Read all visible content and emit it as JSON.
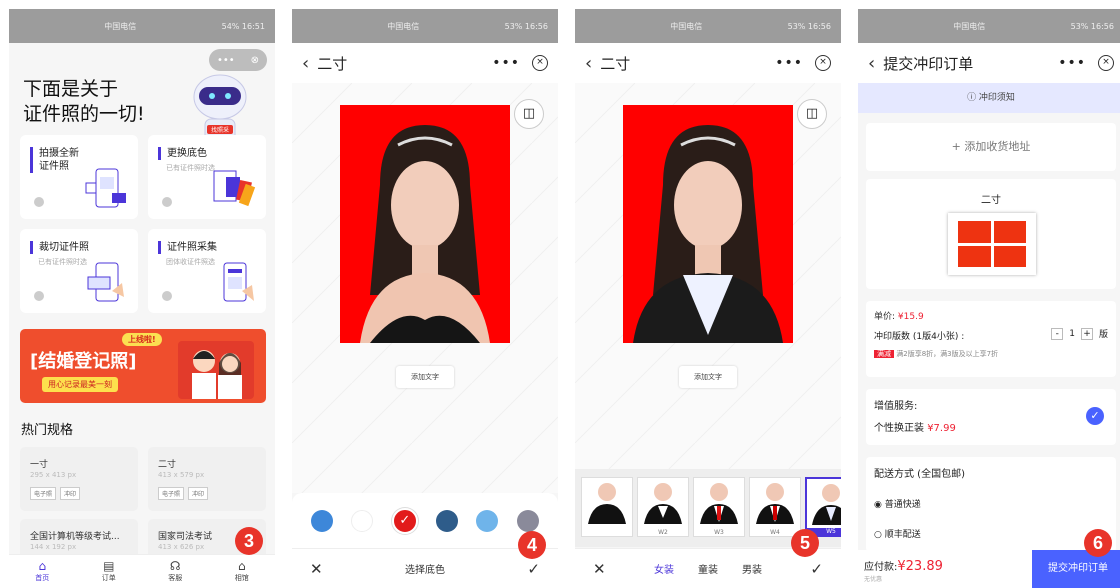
{
  "status": {
    "carrier": "中国电信",
    "p1_right": "54% 16:51",
    "p2_right": "53% 16:56",
    "p3_right": "53% 16:56",
    "p4_right": "53% 16:56"
  },
  "step_numbers": [
    "3",
    "4",
    "5",
    "6"
  ],
  "p1": {
    "headline": [
      "下面是关于",
      "证件照的一切!"
    ],
    "capsule_more": "•••",
    "capsule_close": "⊗",
    "robot_badge": "找照采",
    "cards": [
      {
        "title": "拍摄全新",
        "title2": "证件照",
        "sub": ""
      },
      {
        "title": "更换底色",
        "title2": "",
        "sub": "已有证件照时选"
      },
      {
        "title": "裁切证件照",
        "title2": "",
        "sub": "已有证件照时选"
      },
      {
        "title": "证件照采集",
        "title2": "",
        "sub": "团体收证件照选"
      }
    ],
    "banner": {
      "tag": "上线啦!",
      "title": "[结婚登记照]",
      "sub": "用心记录最美一刻"
    },
    "section_title": "热门规格",
    "specs": [
      {
        "name": "一寸",
        "dims": "295 x 413 px",
        "chips": [
          "电子照",
          "冲印"
        ]
      },
      {
        "name": "二寸",
        "dims": "413 x 579 px",
        "chips": [
          "电子照",
          "冲印"
        ]
      },
      {
        "name": "全国计算机等级考试...",
        "dims": "144 x 192 px",
        "chips": []
      },
      {
        "name": "国家司法考试",
        "dims": "413 x 626 px",
        "chips": []
      }
    ],
    "tabs": [
      {
        "icon": "⌂",
        "label": "首页"
      },
      {
        "icon": "▤",
        "label": "订单"
      },
      {
        "icon": "☊",
        "label": "客服"
      },
      {
        "icon": "⌂",
        "label": "相馆"
      }
    ]
  },
  "p2": {
    "title": "二寸",
    "add_text": "添加文字",
    "bottom_label": "选择底色",
    "swatches": [
      "#3d87d9",
      "#ffffff",
      "#e21b1b",
      "#2e5c8a",
      "#6fb4ea",
      "#8a8a9a"
    ],
    "selected_mark": "✓"
  },
  "p3": {
    "title": "二寸",
    "add_text": "添加文字",
    "suits": [
      "",
      "W2",
      "W3",
      "W4",
      "W5"
    ],
    "genders": [
      "女装",
      "童装",
      "男装"
    ]
  },
  "p4": {
    "title": "提交冲印订单",
    "notice": "ⓘ 冲印须知",
    "add_address": "+ 添加收货地址",
    "sheet_name": "二寸",
    "unit_price_label": "单价:",
    "unit_price": "¥15.9",
    "qty_label": "冲印版数 (1版4小张) :",
    "qty_minus": "-",
    "qty_value": "1",
    "qty_plus": "+",
    "qty_unit": "版",
    "promo_badge": "满减",
    "promo_text": "满2版享8折，满3版及以上享7折",
    "service_label": "增值服务:",
    "service_item": "个性换正装",
    "service_price": "¥7.99",
    "ship_label": "配送方式 (全国包邮)",
    "ship_options": [
      "普通快递",
      "顺丰配送"
    ],
    "pay_label": "应付款:",
    "pay_amount": "¥23.89",
    "pay_note": "无优惠",
    "submit": "提交冲印订单"
  }
}
